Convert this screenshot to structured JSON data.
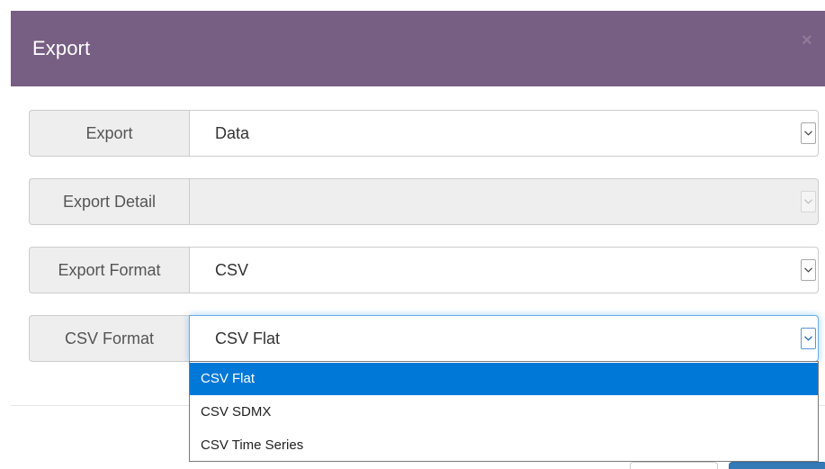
{
  "dialog": {
    "title": "Export",
    "close_icon": "×"
  },
  "form": {
    "rows": [
      {
        "label": "Export",
        "value": "Data",
        "disabled": false,
        "focused": false
      },
      {
        "label": "Export Detail",
        "value": "",
        "disabled": true,
        "focused": false
      },
      {
        "label": "Export Format",
        "value": "CSV",
        "disabled": false,
        "focused": false
      },
      {
        "label": "CSV Format",
        "value": "CSV Flat",
        "disabled": false,
        "focused": true
      }
    ]
  },
  "dropdown": {
    "options": [
      "CSV Flat",
      "CSV SDMX",
      "CSV Time Series"
    ],
    "selected": "CSV Flat"
  },
  "colors": {
    "header_bg": "#775e83",
    "selected_option_bg": "#0078d7",
    "focus_border": "#66afe9",
    "primary_button": "#337ab7"
  },
  "icons": {
    "close": "close-icon",
    "select_arrow": "chevron-down-icon"
  }
}
